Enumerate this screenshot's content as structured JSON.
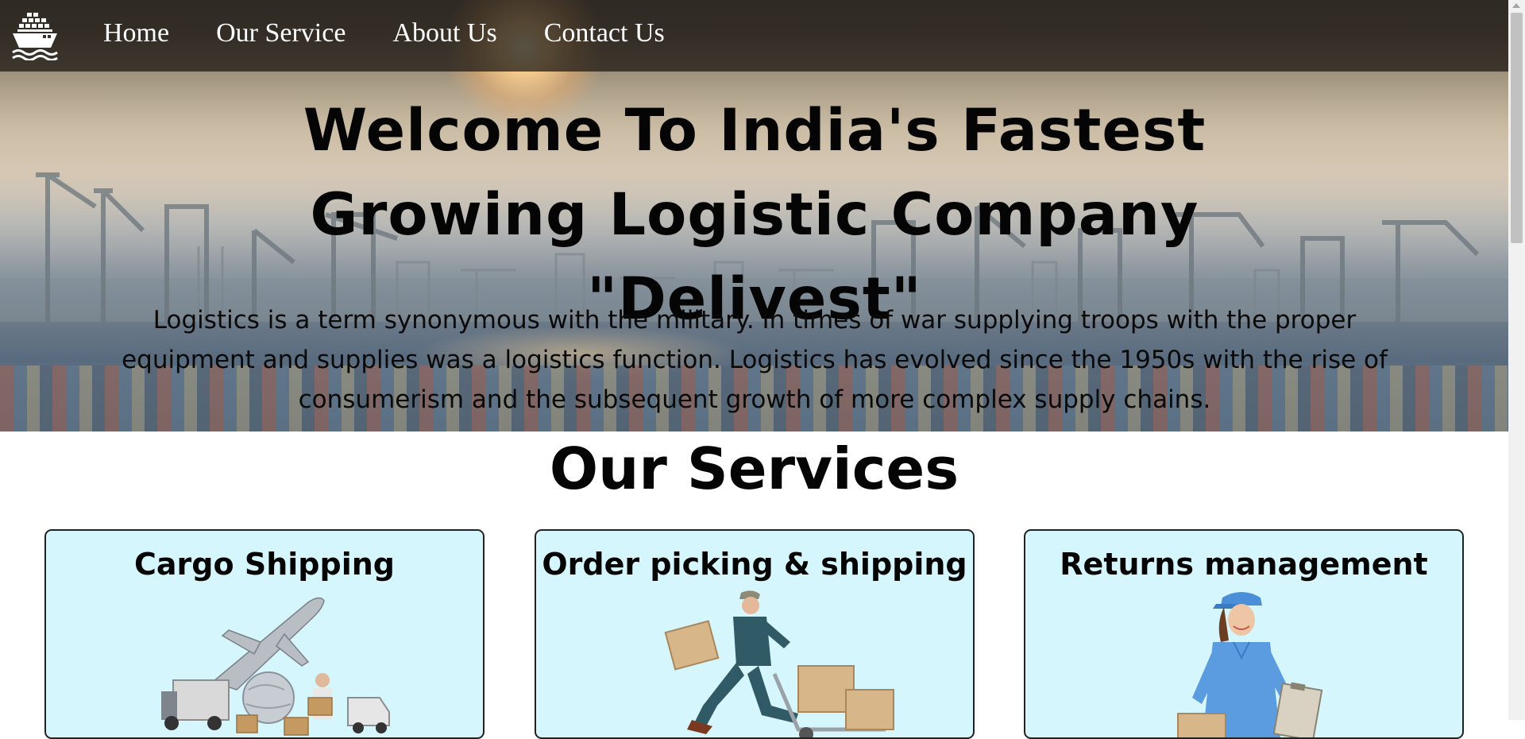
{
  "nav": {
    "logo_icon": "ship-icon",
    "links": [
      "Home",
      "Our Service",
      "About Us",
      "Contact Us"
    ]
  },
  "hero": {
    "title": "Welcome To India's Fastest Growing Logistic Company \"Delivest\"",
    "description": "Logistics is a term synonymous with the military. In times of war supplying troops with the proper equipment and supplies was a logistics function. Logistics has evolved since the 1950s with the rise of consumerism and the subsequent growth of more complex supply chains."
  },
  "services": {
    "title": "Our Services",
    "cards": [
      {
        "title": "Cargo Shipping"
      },
      {
        "title": "Order picking & shipping"
      },
      {
        "title": "Returns management"
      }
    ]
  },
  "colors": {
    "nav_bg": "#28221c",
    "card_bg": "#d6f6fd",
    "text": "#050505"
  }
}
